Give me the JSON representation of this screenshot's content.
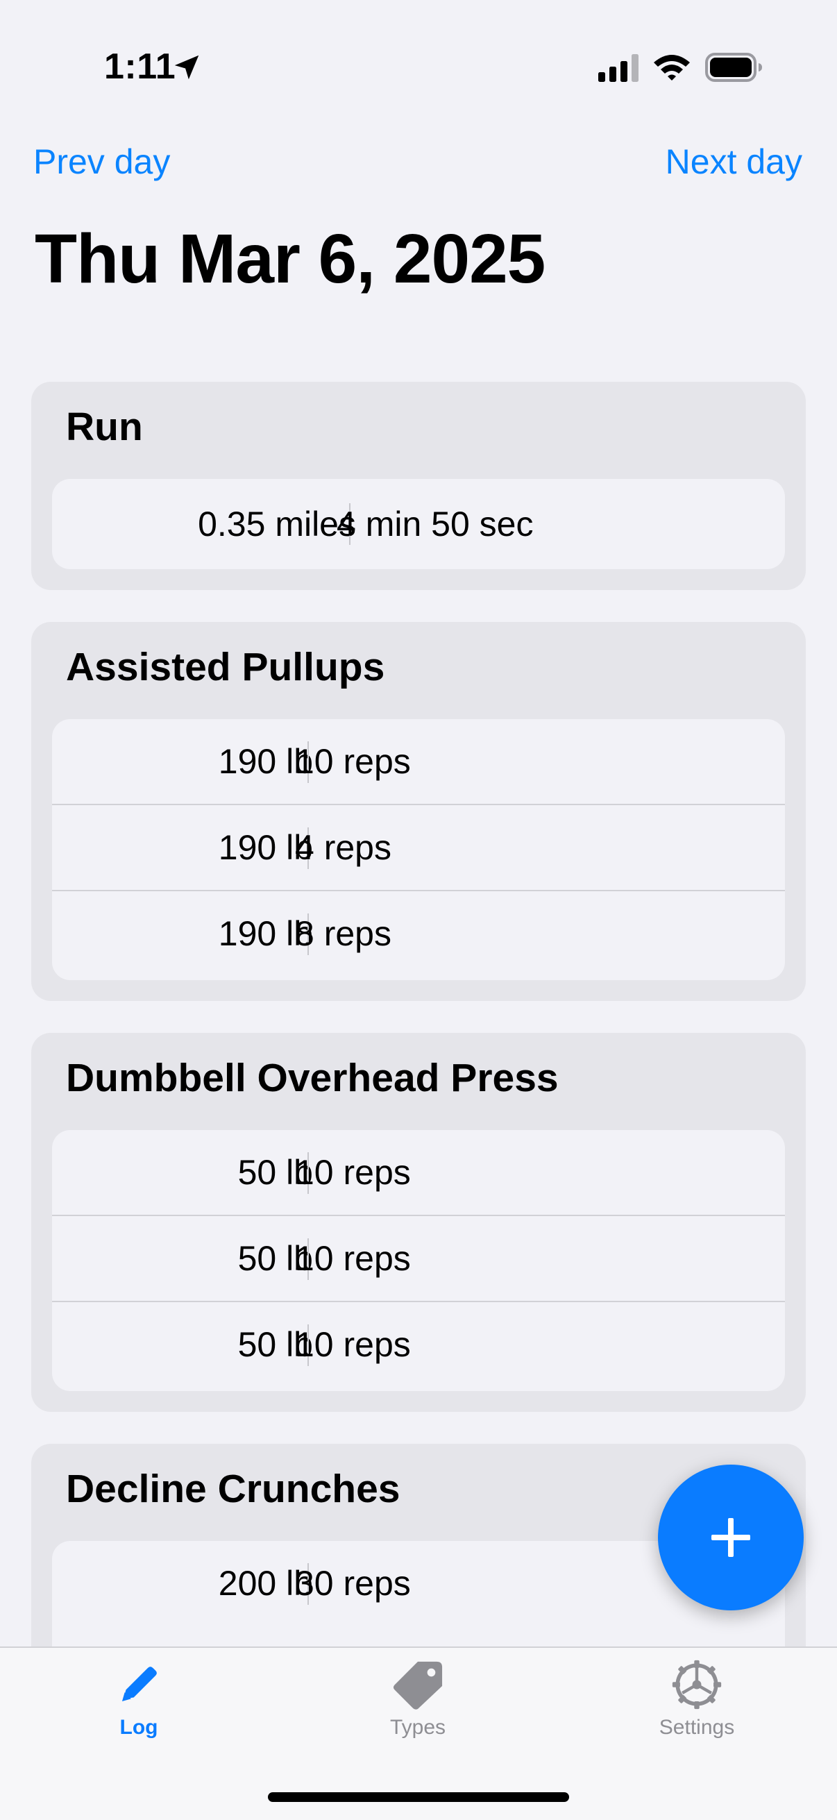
{
  "status_bar": {
    "time": "1:11",
    "icons": [
      "location-arrow-icon",
      "cellular-signal-icon",
      "wifi-icon",
      "battery-icon"
    ]
  },
  "nav": {
    "prev_label": "Prev day",
    "next_label": "Next day",
    "title": "Thu Mar 6, 2025"
  },
  "colors": {
    "accent": "#0a84ff",
    "card_bg": "#e5e5ea",
    "row_bg": "#f2f2f7",
    "page_bg": "#f2f2f7"
  },
  "exercises": [
    {
      "name": "Run",
      "sets": [
        {
          "left": "0.35 miles",
          "right": "4 min 50 sec"
        }
      ]
    },
    {
      "name": "Assisted Pullups",
      "sets": [
        {
          "left": "190 lb",
          "right": "10 reps"
        },
        {
          "left": "190 lb",
          "right": "4 reps"
        },
        {
          "left": "190 lb",
          "right": "8 reps"
        }
      ]
    },
    {
      "name": "Dumbbell Overhead Press",
      "sets": [
        {
          "left": "50 lb",
          "right": "10 reps"
        },
        {
          "left": "50 lb",
          "right": "10 reps"
        },
        {
          "left": "50 lb",
          "right": "10 reps"
        }
      ]
    },
    {
      "name": "Decline Crunches",
      "sets": [
        {
          "left": "200 lb",
          "right": "30 reps"
        }
      ]
    }
  ],
  "fab": {
    "icon": "plus-icon"
  },
  "tab_bar": {
    "tabs": [
      {
        "label": "Log",
        "icon": "pencil-icon",
        "selected": true
      },
      {
        "label": "Types",
        "icon": "tag-icon",
        "selected": false
      },
      {
        "label": "Settings",
        "icon": "gear-icon",
        "selected": false
      }
    ]
  }
}
